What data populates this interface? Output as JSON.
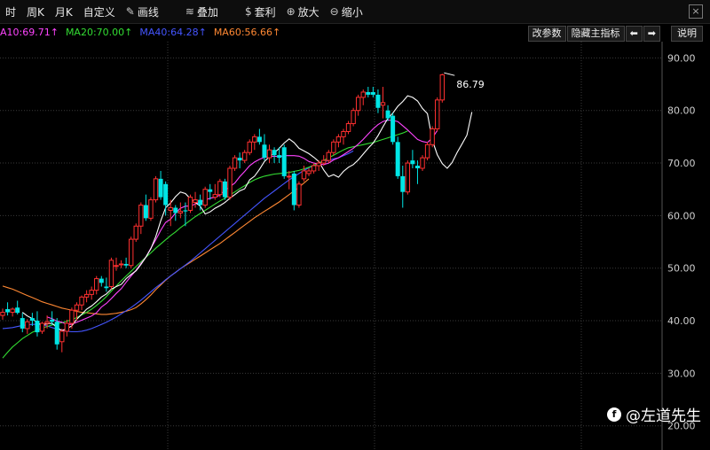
{
  "toolbar": {
    "items": [
      {
        "label": "时",
        "icon": ""
      },
      {
        "label": "周K",
        "icon": ""
      },
      {
        "label": "月K",
        "icon": ""
      },
      {
        "label": "自定义",
        "icon": ""
      },
      {
        "label": "画线",
        "icon": "pencil-icon"
      },
      {
        "label": "叠加",
        "icon": "stack-icon"
      },
      {
        "label": "套利",
        "icon": "money-bag-icon"
      },
      {
        "label": "放大",
        "icon": "zoom-in-icon"
      },
      {
        "label": "缩小",
        "icon": "zoom-out-icon"
      }
    ],
    "close_label": "×"
  },
  "ma_legend": [
    {
      "label": "A10:69.71↑",
      "color": "#ff44ff"
    },
    {
      "label": "MA20:70.00↑",
      "color": "#33dd33"
    },
    {
      "label": "MA40:64.28↑",
      "color": "#4455ff"
    },
    {
      "label": "MA60:56.66↑",
      "color": "#ff8833"
    }
  ],
  "right_buttons": {
    "params": "改参数",
    "hide_main": "隐藏主指标",
    "prev": "⬅",
    "next": "➡",
    "explain": "说明"
  },
  "watermark": {
    "logo": "f",
    "text": "@左道先生"
  },
  "chart_data": {
    "type": "candlestick",
    "y_axis": {
      "ticks": [
        "90.00",
        "80.00",
        "70.00",
        "60.00",
        "50.00",
        "40.00",
        "30.00",
        "20.00"
      ],
      "ylim": [
        15.4,
        93.1
      ]
    },
    "last_price_label": "86.79",
    "colors": {
      "up": "#ff3030",
      "down": "#00e5e5",
      "ma5": "#ffffff",
      "ma10": "#ff44ff",
      "ma20": "#33dd33",
      "ma40": "#4455ff",
      "ma60": "#ff8833"
    },
    "candles": [
      {
        "o": 41,
        "h": 42.3,
        "l": 40.2,
        "c": 41.6
      },
      {
        "o": 42.2,
        "h": 43.5,
        "l": 41,
        "c": 41.6
      },
      {
        "o": 41.6,
        "h": 42.5,
        "l": 40.8,
        "c": 42.2
      },
      {
        "o": 42.5,
        "h": 43.8,
        "l": 41.2,
        "c": 41.5
      },
      {
        "o": 40.5,
        "h": 41.5,
        "l": 37.8,
        "c": 38.5
      },
      {
        "o": 38.5,
        "h": 40.3,
        "l": 37.5,
        "c": 39.8
      },
      {
        "o": 40.5,
        "h": 41.5,
        "l": 39,
        "c": 40
      },
      {
        "o": 40,
        "h": 41.8,
        "l": 37,
        "c": 37.8
      },
      {
        "o": 38,
        "h": 39.8,
        "l": 37.5,
        "c": 39.5
      },
      {
        "o": 39.5,
        "h": 41,
        "l": 38.5,
        "c": 39.8
      },
      {
        "o": 40.2,
        "h": 41.8,
        "l": 39.2,
        "c": 39.8
      },
      {
        "o": 39.8,
        "h": 40.5,
        "l": 34.5,
        "c": 35.5
      },
      {
        "o": 36,
        "h": 38.5,
        "l": 34,
        "c": 38
      },
      {
        "o": 38,
        "h": 40.2,
        "l": 37,
        "c": 39.5
      },
      {
        "o": 39.5,
        "h": 42.5,
        "l": 38.5,
        "c": 42
      },
      {
        "o": 42,
        "h": 43.5,
        "l": 40,
        "c": 43
      },
      {
        "o": 43,
        "h": 44.8,
        "l": 42,
        "c": 44.5
      },
      {
        "o": 44.5,
        "h": 45.8,
        "l": 43.5,
        "c": 45
      },
      {
        "o": 45,
        "h": 46.5,
        "l": 44,
        "c": 45.8
      },
      {
        "o": 45.8,
        "h": 48.5,
        "l": 45,
        "c": 48
      },
      {
        "o": 48,
        "h": 48.5,
        "l": 46.5,
        "c": 47.2
      },
      {
        "o": 46.5,
        "h": 48.2,
        "l": 45.5,
        "c": 46.2
      },
      {
        "o": 46.5,
        "h": 52,
        "l": 46,
        "c": 51.5
      },
      {
        "o": 50.5,
        "h": 52,
        "l": 49.5,
        "c": 50.5
      },
      {
        "o": 50.8,
        "h": 51.5,
        "l": 50,
        "c": 50.8
      },
      {
        "o": 50.8,
        "h": 52,
        "l": 50,
        "c": 50.5
      },
      {
        "o": 50.5,
        "h": 56,
        "l": 50,
        "c": 55.5
      },
      {
        "o": 55.5,
        "h": 58.5,
        "l": 55,
        "c": 58
      },
      {
        "o": 58,
        "h": 62.5,
        "l": 56.5,
        "c": 62
      },
      {
        "o": 62,
        "h": 64,
        "l": 59,
        "c": 59.5
      },
      {
        "o": 59.5,
        "h": 63.5,
        "l": 59,
        "c": 63
      },
      {
        "o": 63,
        "h": 67.5,
        "l": 62.5,
        "c": 67
      },
      {
        "o": 67,
        "h": 68.5,
        "l": 63,
        "c": 63.5
      },
      {
        "o": 66,
        "h": 66.5,
        "l": 60,
        "c": 62
      },
      {
        "o": 61,
        "h": 63,
        "l": 58,
        "c": 61.5
      },
      {
        "o": 61.5,
        "h": 62,
        "l": 59,
        "c": 60.5
      },
      {
        "o": 60.5,
        "h": 62.5,
        "l": 59.5,
        "c": 60.8
      },
      {
        "o": 61,
        "h": 62.5,
        "l": 58,
        "c": 60.8
      },
      {
        "o": 61,
        "h": 64,
        "l": 60.5,
        "c": 63.5
      },
      {
        "o": 62.5,
        "h": 64.5,
        "l": 61.5,
        "c": 63
      },
      {
        "o": 63,
        "h": 64,
        "l": 61,
        "c": 62
      },
      {
        "o": 62,
        "h": 65.5,
        "l": 61.5,
        "c": 65
      },
      {
        "o": 65,
        "h": 66,
        "l": 63,
        "c": 64.5
      },
      {
        "o": 63.5,
        "h": 66,
        "l": 63,
        "c": 64
      },
      {
        "o": 64,
        "h": 67,
        "l": 63.5,
        "c": 66.5
      },
      {
        "o": 66.5,
        "h": 67,
        "l": 63,
        "c": 63.5
      },
      {
        "o": 63.5,
        "h": 69.5,
        "l": 63,
        "c": 69
      },
      {
        "o": 69,
        "h": 71.5,
        "l": 68.5,
        "c": 71
      },
      {
        "o": 71,
        "h": 72,
        "l": 69,
        "c": 70.5
      },
      {
        "o": 70.5,
        "h": 72.5,
        "l": 70,
        "c": 72
      },
      {
        "o": 72,
        "h": 74.5,
        "l": 71.5,
        "c": 74
      },
      {
        "o": 74,
        "h": 75.5,
        "l": 72.5,
        "c": 75
      },
      {
        "o": 75,
        "h": 76.5,
        "l": 73.5,
        "c": 74
      },
      {
        "o": 73.5,
        "h": 75.5,
        "l": 70.5,
        "c": 71
      },
      {
        "o": 71,
        "h": 73.5,
        "l": 70,
        "c": 72.5
      },
      {
        "o": 72.5,
        "h": 73,
        "l": 70,
        "c": 71.5
      },
      {
        "o": 71.5,
        "h": 73,
        "l": 70,
        "c": 71
      },
      {
        "o": 73,
        "h": 73.5,
        "l": 67,
        "c": 67.5
      },
      {
        "o": 67.5,
        "h": 68.5,
        "l": 65,
        "c": 67.5
      },
      {
        "o": 68,
        "h": 68.5,
        "l": 61,
        "c": 62
      },
      {
        "o": 62,
        "h": 66.5,
        "l": 61.5,
        "c": 66
      },
      {
        "o": 67,
        "h": 69.5,
        "l": 66.5,
        "c": 68.5
      },
      {
        "o": 68,
        "h": 69,
        "l": 67.5,
        "c": 68.5
      },
      {
        "o": 68.5,
        "h": 70,
        "l": 68,
        "c": 69.5
      },
      {
        "o": 69.5,
        "h": 70.5,
        "l": 68.5,
        "c": 70
      },
      {
        "o": 70,
        "h": 71.5,
        "l": 69.5,
        "c": 70.5
      },
      {
        "o": 70.5,
        "h": 72.5,
        "l": 70,
        "c": 72
      },
      {
        "o": 72,
        "h": 74.5,
        "l": 71.5,
        "c": 74
      },
      {
        "o": 74,
        "h": 75.5,
        "l": 73,
        "c": 75
      },
      {
        "o": 75,
        "h": 76.5,
        "l": 73.5,
        "c": 76
      },
      {
        "o": 76,
        "h": 78,
        "l": 75.5,
        "c": 77.5
      },
      {
        "o": 77.5,
        "h": 80.5,
        "l": 77,
        "c": 80
      },
      {
        "o": 80,
        "h": 83,
        "l": 79,
        "c": 82.5
      },
      {
        "o": 82.5,
        "h": 84,
        "l": 81,
        "c": 83.5
      },
      {
        "o": 83.5,
        "h": 84.5,
        "l": 82.5,
        "c": 83
      },
      {
        "o": 83.5,
        "h": 84.5,
        "l": 82.5,
        "c": 83
      },
      {
        "o": 83,
        "h": 84,
        "l": 79.5,
        "c": 80.5
      },
      {
        "o": 81,
        "h": 84.5,
        "l": 78.5,
        "c": 81.5
      },
      {
        "o": 80,
        "h": 81,
        "l": 78,
        "c": 78.5
      },
      {
        "o": 79,
        "h": 79.5,
        "l": 73.5,
        "c": 74
      },
      {
        "o": 74,
        "h": 75,
        "l": 67,
        "c": 67.5
      },
      {
        "o": 67.5,
        "h": 69.5,
        "l": 61.5,
        "c": 64.5
      },
      {
        "o": 64.5,
        "h": 70.5,
        "l": 64,
        "c": 70
      },
      {
        "o": 70.5,
        "h": 72.5,
        "l": 69,
        "c": 69.8
      },
      {
        "o": 69.5,
        "h": 70.5,
        "l": 66,
        "c": 69
      },
      {
        "o": 69,
        "h": 71.5,
        "l": 68.5,
        "c": 71
      },
      {
        "o": 71,
        "h": 74,
        "l": 70.5,
        "c": 73.5
      },
      {
        "o": 73.5,
        "h": 77,
        "l": 73,
        "c": 76.5
      },
      {
        "o": 76.5,
        "h": 82.5,
        "l": 76,
        "c": 82
      },
      {
        "o": 82,
        "h": 87,
        "l": 81.5,
        "c": 86.79
      }
    ],
    "ma_lines": {
      "ma5": {
        "start_index": 4,
        "values": [
          41.6,
          40.9,
          40.4,
          39.6,
          39.2,
          39.4,
          39.5,
          38.7,
          38.1,
          38.5,
          39,
          40.3,
          41.2,
          42.2,
          42.8,
          43.6,
          44.5,
          45.1,
          46,
          46.5,
          46.9,
          48,
          48.8,
          49.5,
          50.7,
          52.1,
          53.7,
          56,
          59,
          61.5,
          62.4,
          63.6,
          64.5,
          64.2,
          63.2,
          62.5,
          61.8,
          60.3,
          60.7,
          61.4,
          61.9,
          62.5,
          63.3,
          64,
          64.7,
          65.1,
          66.8,
          67.5,
          68.8,
          70.3,
          71.2,
          71.9,
          72.8,
          73.8,
          74.6,
          73.9,
          72.8,
          72.3,
          71.8,
          71.1,
          70.3,
          68.7,
          67.4,
          67.8,
          67.3,
          68.4,
          69.2,
          69.7,
          70.6,
          71.7,
          72.8,
          73.8,
          75.2,
          76.9,
          78.5,
          79.5,
          80.8,
          81.7,
          82.8,
          82.5,
          81.8,
          80.4,
          79.4,
          74.3,
          71.6,
          69.9,
          69,
          70.1,
          72,
          73.6,
          75.3,
          79.7
        ]
      },
      "ma10": {
        "start_index": 9,
        "values": [
          40.7,
          40.4,
          39.9,
          39.7,
          39.3,
          39.3,
          39.7,
          40.1,
          40.5,
          40.9,
          41.5,
          42.6,
          43.3,
          44.2,
          45.2,
          46.1,
          47.3,
          48.5,
          49.6,
          50.9,
          52.1,
          53.8,
          55.4,
          57.2,
          58.7,
          59.3,
          60.5,
          61.4,
          61.8,
          61.8,
          62.2,
          62.6,
          63,
          63.3,
          63.5,
          63.9,
          64.8,
          65.5,
          66.2,
          67.4,
          68.4,
          69.5,
          70.2,
          70.7,
          71.1,
          71.2,
          71.3,
          71.2,
          71.4,
          71.4,
          71.4,
          71.3,
          70.9,
          70.3,
          70,
          69.8,
          69.7,
          70,
          70.6,
          71,
          71.6,
          72.2,
          72.8,
          73.6,
          74.5,
          75.5,
          76.5,
          77.3,
          77.9,
          78.2,
          78.1,
          77.9,
          77.1,
          76.3,
          75.4,
          74.5,
          74.1,
          73.9,
          74.8,
          76.2
        ]
      },
      "ma20": {
        "start_index": 0,
        "values": [
          32.9,
          34,
          35,
          35.8,
          36.6,
          37.2,
          37.8,
          38.2,
          38.6,
          38.9,
          39.2,
          39.4,
          39.6,
          39.9,
          40.2,
          40.6,
          41.1,
          41.6,
          42.2,
          42.9,
          43.7,
          44.6,
          45.6,
          46.6,
          47.6,
          48.5,
          49.4,
          50.3,
          51.2,
          52.1,
          52.9,
          53.8,
          54.6,
          55.4,
          56.2,
          56.9,
          57.7,
          58.4,
          59.1,
          59.8,
          60.4,
          61,
          61.6,
          62.2,
          62.8,
          63.3,
          63.9,
          64.5,
          65.1,
          65.7,
          66.3,
          66.8,
          67.2,
          67.5,
          67.7,
          67.9,
          68,
          68.1,
          68.2,
          68.4,
          68.6,
          68.9,
          69.2,
          69.6,
          70,
          70.5,
          71,
          71.5,
          72,
          72.5,
          72.9,
          73.1,
          73.3,
          73.5,
          73.7,
          73.9,
          74.2,
          74.5,
          74.8,
          75.1,
          75.4,
          75.7,
          76.1
        ]
      },
      "ma40": {
        "start_index": 0,
        "values": [
          38.5,
          38.6,
          38.7,
          38.9,
          39.1,
          39.2,
          39.3,
          39.3,
          39.2,
          39,
          38.7,
          38.4,
          38.2,
          38,
          37.9,
          37.9,
          38,
          38.2,
          38.5,
          38.9,
          39.3,
          39.7,
          40.2,
          40.7,
          41.3,
          41.9,
          42.5,
          43.2,
          43.9,
          44.7,
          45.5,
          46.3,
          47,
          47.8,
          48.5,
          49.2,
          49.9,
          50.6,
          51.3,
          52.1,
          52.9,
          53.7,
          54.5,
          55.3,
          56.1,
          56.9,
          57.7,
          58.5,
          59.3,
          60.1,
          60.9,
          61.7,
          62.5,
          63.3,
          64,
          64.7,
          65.4,
          66.1,
          66.8,
          67.4,
          68,
          68.6,
          69.1,
          69.5,
          69.9,
          70.2,
          70.5,
          70.8,
          71,
          71.4,
          71.8,
          72.3
        ]
      },
      "ma60": {
        "start_index": 0,
        "values": [
          46.6,
          46.3,
          46,
          45.6,
          45.2,
          44.8,
          44.4,
          44,
          43.6,
          43.3,
          43,
          42.7,
          42.4,
          42.2,
          42,
          41.8,
          41.6,
          41.5,
          41.4,
          41.3,
          41.2,
          41.2,
          41.3,
          41.4,
          41.6,
          41.8,
          42.1,
          42.5,
          43.2,
          44,
          44.9,
          45.9,
          46.8,
          47.7,
          48.5,
          49.2,
          49.9,
          50.5,
          51.1,
          51.7,
          52.3,
          52.9,
          53.5,
          54.1,
          54.7,
          55.4,
          56.1,
          56.8,
          57.5,
          58.2,
          58.9,
          59.6,
          60.2,
          60.8,
          61.4,
          62,
          62.6,
          63.3,
          64,
          64.7,
          65.4,
          66.2,
          67
        ]
      }
    }
  }
}
